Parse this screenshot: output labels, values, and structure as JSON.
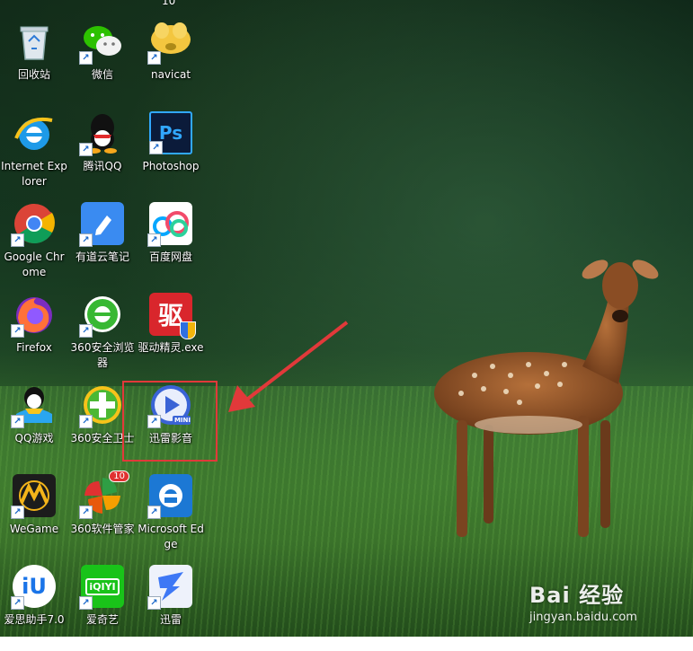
{
  "desktop": {
    "top_partial_label": "10",
    "icons": [
      {
        "label": "回收站",
        "icon": "recycle-bin-icon",
        "shortcut": false
      },
      {
        "label": "微信",
        "icon": "wechat-icon",
        "shortcut": true
      },
      {
        "label": "navicat",
        "icon": "navicat-icon",
        "shortcut": true
      },
      {
        "label": "Internet Explorer",
        "icon": "internet-explorer-icon",
        "shortcut": false
      },
      {
        "label": "腾讯QQ",
        "icon": "qq-icon",
        "shortcut": true
      },
      {
        "label": "Photoshop",
        "icon": "photoshop-icon",
        "shortcut": true,
        "glyph": "Ps"
      },
      {
        "label": "Google Chrome",
        "icon": "chrome-icon",
        "shortcut": true
      },
      {
        "label": "有道云笔记",
        "icon": "youdao-note-icon",
        "shortcut": true
      },
      {
        "label": "百度网盘",
        "icon": "baidu-netdisk-icon",
        "shortcut": true
      },
      {
        "label": "Firefox",
        "icon": "firefox-icon",
        "shortcut": true
      },
      {
        "label": "360安全浏览器",
        "icon": "360-browser-icon",
        "shortcut": true
      },
      {
        "label": "驱动精灵.exe",
        "icon": "driver-genius-icon",
        "shortcut": false,
        "glyph": "驱"
      },
      {
        "label": "QQ游戏",
        "icon": "qq-game-icon",
        "shortcut": true
      },
      {
        "label": "360安全卫士",
        "icon": "360-safe-icon",
        "shortcut": true
      },
      {
        "label": "迅雷影音",
        "icon": "xunlei-player-icon",
        "shortcut": true,
        "glyph": "MINI"
      },
      {
        "label": "WeGame",
        "icon": "wegame-icon",
        "shortcut": true
      },
      {
        "label": "360软件管家",
        "icon": "360-software-manager-icon",
        "shortcut": true,
        "badge": "10"
      },
      {
        "label": "Microsoft Edge",
        "icon": "edge-icon",
        "shortcut": true
      },
      {
        "label": "爱思助手7.0",
        "icon": "i4-assistant-icon",
        "shortcut": true,
        "glyph": "iU"
      },
      {
        "label": "爱奇艺",
        "icon": "iqiyi-icon",
        "shortcut": true,
        "glyph": "iQIYI"
      },
      {
        "label": "迅雷",
        "icon": "xunlei-icon",
        "shortcut": true
      }
    ]
  },
  "annotation": {
    "highlight_color": "#e1393a",
    "arrow_color": "#e1393a"
  },
  "watermark": {
    "logo_text": "Bai 经验",
    "url": "jingyan.baidu.com"
  }
}
